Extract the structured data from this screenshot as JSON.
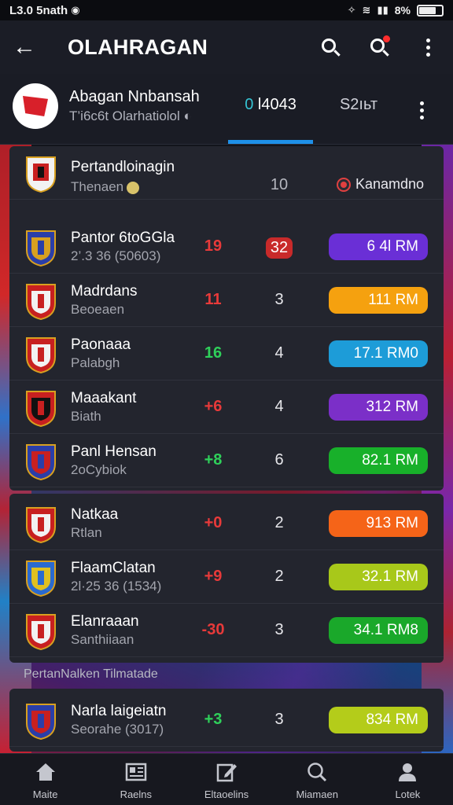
{
  "status_bar": {
    "time": "L3.0 5nath",
    "battery": "8%"
  },
  "app_bar": {
    "title": "OLAHRAGAN"
  },
  "league": {
    "name": "Abagan Nnbansah",
    "subtitle": "T’i6c6t Olarhatiolol",
    "tab_score_lead": "0",
    "tab_score": "l4043",
    "tab_second": "S2ıьт"
  },
  "header_row": {
    "team": "Pertandloinagin",
    "meta": "Thenaen",
    "points": "10",
    "right_label": "Kanamdno"
  },
  "rows_card1": [
    {
      "team": "Pantor 6toGGla",
      "meta": "2’.3 36 (50603)",
      "form": "19",
      "form_color": "#e83a3a",
      "points": "32",
      "points_badge": true,
      "value": "6 4l RM",
      "pill_color": "#6a2fd6"
    },
    {
      "team": "Madrdans",
      "meta": "Beoeaen",
      "form": "11",
      "form_color": "#e83a3a",
      "points": "3",
      "points_badge": false,
      "value": "111 RM",
      "pill_color": "#f5a10f"
    },
    {
      "team": "Paonaaa",
      "meta": "Palabgh",
      "form": "16",
      "form_color": "#2fd05a",
      "points": "4",
      "points_badge": false,
      "value": "17.1 RM0",
      "pill_color": "#1d9cd8"
    },
    {
      "team": "Maaakant",
      "meta": "Biath",
      "form": "+6",
      "form_color": "#e83a3a",
      "points": "4",
      "points_badge": false,
      "value": "312 RM",
      "pill_color": "#7b2fc8"
    },
    {
      "team": "Panl Hensan",
      "meta": "2oСybiok",
      "form": "+8",
      "form_color": "#2fd05a",
      "points": "6",
      "points_badge": false,
      "value": "82.1 RM",
      "pill_color": "#18b02a"
    }
  ],
  "rows_card2": [
    {
      "team": "Natkaa",
      "meta": "Rtlan",
      "form": "+0",
      "form_color": "#e83a3a",
      "points": "2",
      "value": "913 RM",
      "pill_color": "#f56418"
    },
    {
      "team": "FlaamClatan",
      "meta": "2l·25 36 (1534)",
      "form": "+9",
      "form_color": "#e83a3a",
      "points": "2",
      "value": "32.1 RM",
      "pill_color": "#a8c81a"
    },
    {
      "team": "Elanraaan",
      "meta": "Santhiiaan",
      "form": "-30",
      "form_color": "#e83a3a",
      "points": "3",
      "value": "34.1 RM8",
      "pill_color": "#1aa82a"
    }
  ],
  "section_label": "PertanNalken Tilmatade",
  "rows_card3": [
    {
      "team": "Narla laigeiatn",
      "meta": "Seorahe (3017)",
      "form": "+3",
      "form_color": "#2fd05a",
      "points": "3",
      "value": "834 RM",
      "pill_color": "#b4cc1a"
    }
  ],
  "bottom_nav": [
    {
      "label": "Maite",
      "icon": "home-icon"
    },
    {
      "label": "Raelns",
      "icon": "news-icon"
    },
    {
      "label": "Eltaoelins",
      "icon": "edit-icon"
    },
    {
      "label": "Miamaen",
      "icon": "search-icon"
    },
    {
      "label": "Lotek",
      "icon": "profile-icon"
    }
  ]
}
